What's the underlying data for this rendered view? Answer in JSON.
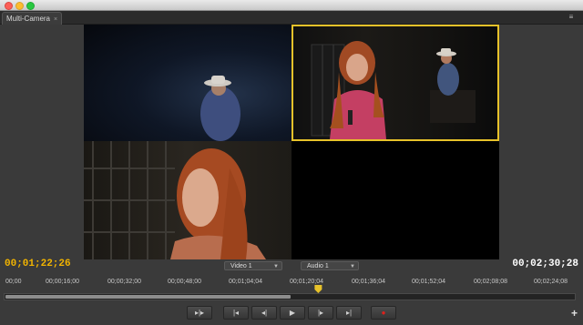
{
  "tab": {
    "label": "Multi-Camera",
    "close": "×"
  },
  "panel_menu_icon": "≡",
  "colors": {
    "accent": "#e7c22a",
    "timecode": "#f2b400",
    "record": "#e0201b"
  },
  "timecode_current": "00;01;22;26",
  "timecode_duration": "00;02;30;28",
  "dropdowns": {
    "video": "Video 1",
    "audio": "Audio 1"
  },
  "ruler_ticks": [
    "00;00",
    "00;00;16;00",
    "00;00;32;00",
    "00;00;48;00",
    "00;01;04;04",
    "00;01;20;04",
    "00;01;36;04",
    "00;01;52;04",
    "00;02;08;08",
    "00;02;24;08"
  ],
  "playhead_fraction": 0.55,
  "cameras": [
    "camera-1",
    "camera-2",
    "camera-3",
    "camera-4"
  ],
  "active_camera": 2,
  "controls": {
    "step_in_out": "▸|▸",
    "go_to_in": "|◂",
    "step_back": "◂|",
    "play": "▶",
    "step_forward": "|▸",
    "go_to_out": "▸|",
    "record": "●"
  },
  "add_button": "+"
}
